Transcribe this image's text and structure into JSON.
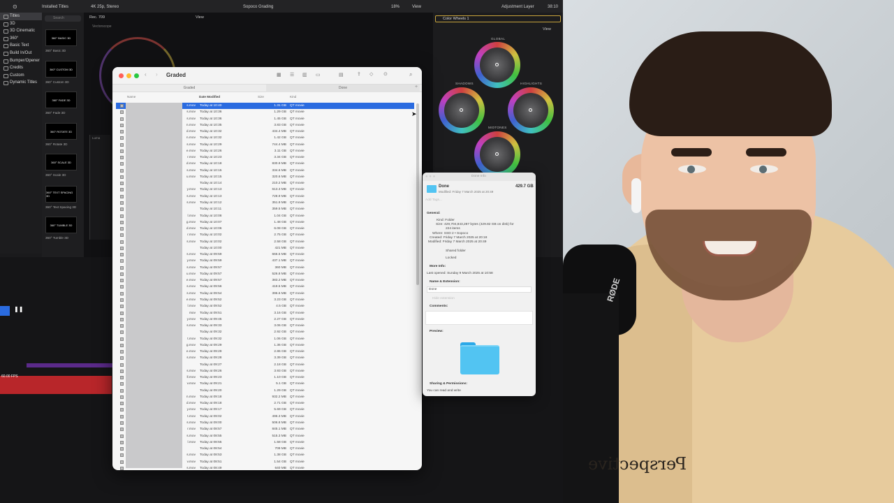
{
  "fcp": {
    "library_header": "Installed Titles",
    "search_placeholder": "Search",
    "format": "4K 25p, Stereo",
    "project": "Sopoco Grading",
    "zoom": "18%",
    "view": "View",
    "view2": "View",
    "adjustment_layer": "Adjustment Layer",
    "timecode": "38:10",
    "rec": "Rec. 709",
    "vectorscope": "Vectorscope",
    "luma": "Luma",
    "fps": "60.00 FPS",
    "color_wheels": "Color Wheels 1",
    "view_inspector": "View",
    "wheel_labels": [
      "GLOBAL",
      "SHADOWS",
      "HIGHLIGHTS",
      "MIDTONES"
    ],
    "library_items": [
      "Titles",
      "3D",
      "3D Cinematic",
      "360°",
      "Basic Text",
      "Build In/Out",
      "Bumper/Opener",
      "Credits",
      "Custom",
      "Dynamic Titles"
    ],
    "thumbs": [
      {
        "name": "360° Basic 3D",
        "label": "360° BASIC 3D"
      },
      {
        "name": "360° Custom 3D",
        "label": "360° CUSTOM 3D"
      },
      {
        "name": "360° Fade 3D",
        "label": "360° FADE 3D"
      },
      {
        "name": "360° Rotate 3D",
        "label": "360° ROTATE 3D"
      },
      {
        "name": "360° Scale 3D",
        "label": "360° SCALE 3D"
      },
      {
        "name": "360° Text Spacing 3D",
        "label": "360° TEXT SPACING 3D"
      },
      {
        "name": "360° Tumble 3D",
        "label": "360° TUMBLE 3D"
      }
    ]
  },
  "finder": {
    "title": "Graded",
    "tabs": [
      "Graded",
      "Done"
    ],
    "columns": {
      "name": "Name",
      "date": "Date Modified",
      "size": "Size",
      "kind": "Kind"
    },
    "rows": [
      {
        "name": "s.mov",
        "date": "Today at 10:40",
        "size": "1.31 GB",
        "kind": "QT movie"
      },
      {
        "name": "s.mov",
        "date": "Today at 10:36",
        "size": "1.29 GB",
        "kind": "QT movie"
      },
      {
        "name": "s.mov",
        "date": "Today at 10:36",
        "size": "1.45 GB",
        "kind": "QT movie"
      },
      {
        "name": "n.mov",
        "date": "Today at 10:35",
        "size": "3.83 GB",
        "kind": "QT movie"
      },
      {
        "name": "d.mov",
        "date": "Today at 10:32",
        "size": "434.4 MB",
        "kind": "QT movie"
      },
      {
        "name": "n.mov",
        "date": "Today at 10:32",
        "size": "1.42 GB",
        "kind": "QT movie"
      },
      {
        "name": "s.mov",
        "date": "Today at 10:29",
        "size": "744.4 MB",
        "kind": "QT movie"
      },
      {
        "name": "e.mov",
        "date": "Today at 10:26",
        "size": "3.11 GB",
        "kind": "QT movie"
      },
      {
        "name": "r.mov",
        "date": "Today at 10:23",
        "size": "3.34 GB",
        "kind": "QT movie"
      },
      {
        "name": "d.mov",
        "date": "Today at 10:18",
        "size": "830.9 MB",
        "kind": "QT movie"
      },
      {
        "name": "s.mov",
        "date": "Today at 10:15",
        "size": "334.6 MB",
        "kind": "QT movie"
      },
      {
        "name": "u.mov",
        "date": "Today at 10:15",
        "size": "320.6 MB",
        "kind": "QT movie"
      },
      {
        "name": "",
        "date": "Today at 10:14",
        "size": "210.2 MB",
        "kind": "QT movie"
      },
      {
        "name": "y.mov",
        "date": "Today at 10:13",
        "size": "613.3 MB",
        "kind": "QT movie"
      },
      {
        "name": "s.mov",
        "date": "Today at 10:13",
        "size": "728.9 MB",
        "kind": "QT movie"
      },
      {
        "name": "s.mov",
        "date": "Today at 10:12",
        "size": "351.9 MB",
        "kind": "QT movie"
      },
      {
        "name": "",
        "date": "Today at 10:11",
        "size": "359.5 MB",
        "kind": "QT movie"
      },
      {
        "name": "l.mov",
        "date": "Today at 10:08",
        "size": "1.04 GB",
        "kind": "QT movie"
      },
      {
        "name": "g.mov",
        "date": "Today at 10:07",
        "size": "1.48 GB",
        "kind": "QT movie"
      },
      {
        "name": "d.mov",
        "date": "Today at 10:06",
        "size": "6.08 GB",
        "kind": "QT movie"
      },
      {
        "name": "r.mov",
        "date": "Today at 10:02",
        "size": "2.75 GB",
        "kind": "QT movie"
      },
      {
        "name": "s.mov",
        "date": "Today at 10:02",
        "size": "2.58 GB",
        "kind": "QT movie"
      },
      {
        "name": "",
        "date": "Today at 10:00",
        "size": "421 MB",
        "kind": "QT movie"
      },
      {
        "name": "s.mov",
        "date": "Today at 09:59",
        "size": "666.5 MB",
        "kind": "QT movie"
      },
      {
        "name": "y.mov",
        "date": "Today at 09:59",
        "size": "437.1 MB",
        "kind": "QT movie"
      },
      {
        "name": "s.mov",
        "date": "Today at 09:57",
        "size": "360 MB",
        "kind": "QT movie"
      },
      {
        "name": "u.mov",
        "date": "Today at 09:57",
        "size": "526.8 MB",
        "kind": "QT movie"
      },
      {
        "name": "e.mov",
        "date": "Today at 09:57",
        "size": "383.2 MB",
        "kind": "QT movie"
      },
      {
        "name": "s.mov",
        "date": "Today at 09:56",
        "size": "419.5 MB",
        "kind": "QT movie"
      },
      {
        "name": "s.mov",
        "date": "Today at 09:54",
        "size": "396.6 MB",
        "kind": "QT movie"
      },
      {
        "name": "e.mov",
        "date": "Today at 09:52",
        "size": "3.23 GB",
        "kind": "QT movie"
      },
      {
        "name": "l.mov",
        "date": "Today at 09:52",
        "size": "4.5 GB",
        "kind": "QT movie"
      },
      {
        "name": "mov",
        "date": "Today at 09:51",
        "size": "3.16 GB",
        "kind": "QT movie"
      },
      {
        "name": "y.mov",
        "date": "Today at 09:45",
        "size": "2.27 GB",
        "kind": "QT movie"
      },
      {
        "name": "s.mov",
        "date": "Today at 09:33",
        "size": "3.06 GB",
        "kind": "QT movie"
      },
      {
        "name": "",
        "date": "Today at 09:32",
        "size": "2.92 GB",
        "kind": "QT movie"
      },
      {
        "name": "t.mov",
        "date": "Today at 09:32",
        "size": "1.06 GB",
        "kind": "QT movie"
      },
      {
        "name": "g.mov",
        "date": "Today at 09:29",
        "size": "1.36 GB",
        "kind": "QT movie"
      },
      {
        "name": "e.mov",
        "date": "Today at 09:29",
        "size": "2.86 GB",
        "kind": "QT movie"
      },
      {
        "name": "s.mov",
        "date": "Today at 09:28",
        "size": "3.39 GB",
        "kind": "QT movie"
      },
      {
        "name": "",
        "date": "Today at 09:27",
        "size": "2.18 GB",
        "kind": "QT movie"
      },
      {
        "name": "s.mov",
        "date": "Today at 09:26",
        "size": "3.93 GB",
        "kind": "QT movie"
      },
      {
        "name": "ll.mov",
        "date": "Today at 09:23",
        "size": "1.10 GB",
        "kind": "QT movie"
      },
      {
        "name": "v.mov",
        "date": "Today at 09:21",
        "size": "5.1 GB",
        "kind": "QT movie"
      },
      {
        "name": "",
        "date": "Today at 09:20",
        "size": "1.29 GB",
        "kind": "QT movie"
      },
      {
        "name": "n.mov",
        "date": "Today at 09:18",
        "size": "932.2 MB",
        "kind": "QT movie"
      },
      {
        "name": "d.mov",
        "date": "Today at 09:18",
        "size": "2.71 GB",
        "kind": "QT movie"
      },
      {
        "name": "y.mov",
        "date": "Today at 09:17",
        "size": "5.69 GB",
        "kind": "QT movie"
      },
      {
        "name": "t.mov",
        "date": "Today at 09:02",
        "size": "496.3 MB",
        "kind": "QT movie"
      },
      {
        "name": "s.mov",
        "date": "Today at 09:00",
        "size": "506.8 MB",
        "kind": "QT movie"
      },
      {
        "name": "r.mov",
        "date": "Today at 08:57",
        "size": "845.1 MB",
        "kind": "QT movie"
      },
      {
        "name": "s.mov",
        "date": "Today at 08:55",
        "size": "515.3 MB",
        "kind": "QT movie"
      },
      {
        "name": "l.mov",
        "date": "Today at 08:55",
        "size": "1.58 GB",
        "kind": "QT movie"
      },
      {
        "name": "",
        "date": "Today at 08:54",
        "size": "709 MB",
        "kind": "QT movie"
      },
      {
        "name": "s.mov",
        "date": "Today at 08:53",
        "size": "1.38 GB",
        "kind": "QT movie"
      },
      {
        "name": "v.mov",
        "date": "Today at 08:51",
        "size": "1.54 GB",
        "kind": "QT movie"
      },
      {
        "name": "s.mov",
        "date": "Today at 08:49",
        "size": "640 MB",
        "kind": "QT movie"
      }
    ]
  },
  "info": {
    "window_title": "Done Info",
    "name": "Done",
    "size": "429.7 GB",
    "modified": "Modified: Friday 7 March 2025 at 20:49",
    "add_tags": "Add Tags...",
    "general": "General:",
    "kind": "Kind: Folder",
    "size_line": "Size: 429,704,843,287 bytes (429.82 GB on disk) for",
    "items": "224 items",
    "where": "Where: SSD 2 • Sopoco",
    "created": "Created: Friday 7 March 2025 at 20:18",
    "modified2": "Modified: Friday 7 March 2025 at 20:49",
    "shared": "Shared folder",
    "locked": "Locked",
    "more_info": "More Info:",
    "last_opened": "Last opened: Sunday 9 March 2025 at 10:58",
    "name_ext": "Name & Extension:",
    "name_value": "Done",
    "hide_ext": "Hide extension",
    "comments": "Comments:",
    "preview": "Preview:",
    "sharing": "Sharing & Permissions:",
    "permissions": "You can read and write"
  },
  "video": {
    "hoodie_print": "Perspective",
    "mic_brand": "RØDE"
  }
}
